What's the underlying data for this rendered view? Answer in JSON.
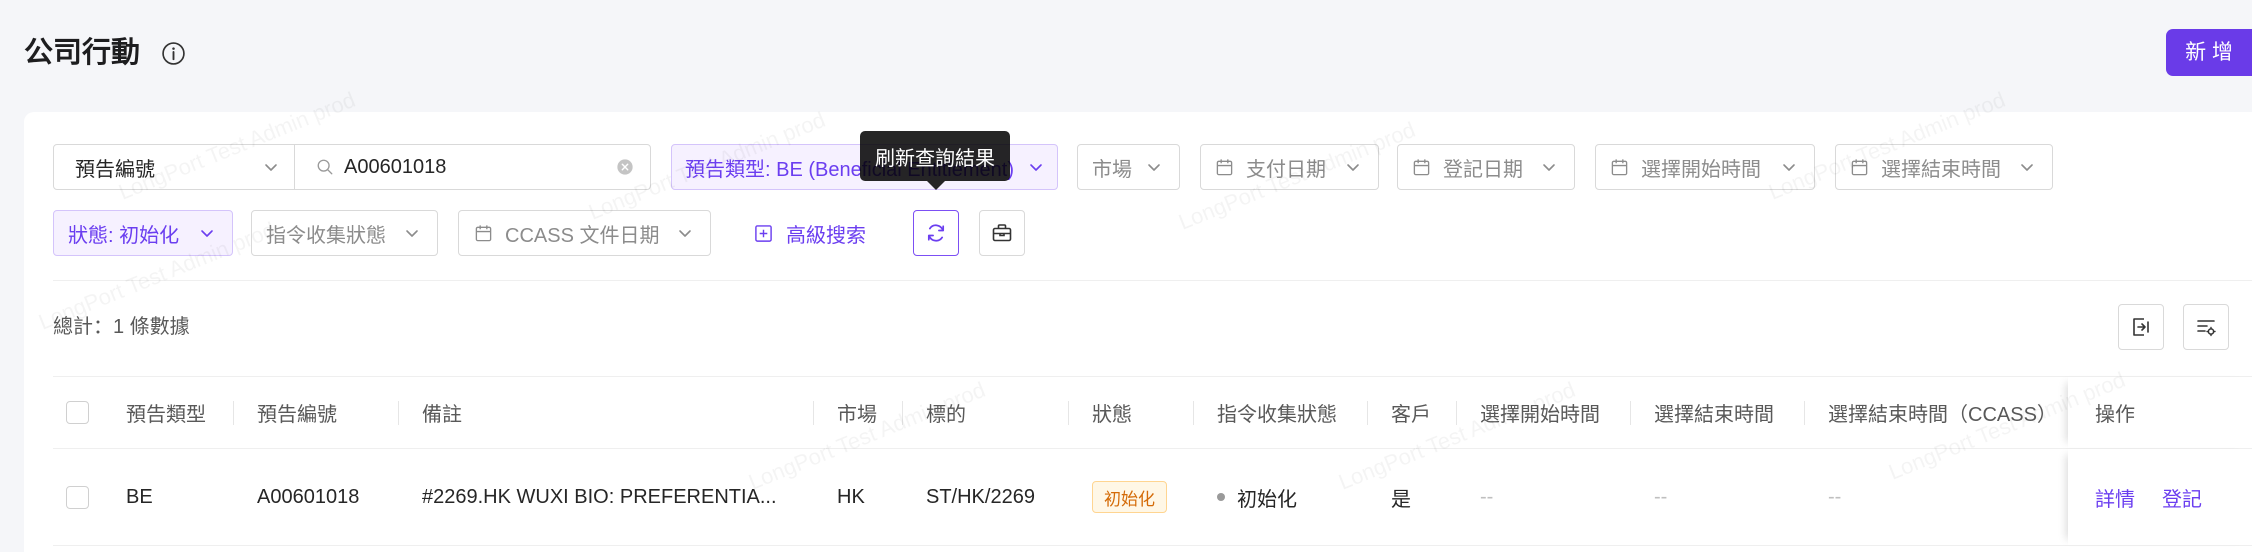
{
  "header": {
    "title": "公司行動",
    "add_button": "新 增"
  },
  "filters": {
    "search_field_select": "預告編號",
    "search_value": "A00601018",
    "notice_type": "預告類型: BE (Beneficial Entitlement)",
    "market_placeholder": "市場",
    "payment_date_placeholder": "支付日期",
    "record_date_placeholder": "登記日期",
    "select_start_placeholder": "選擇開始時間",
    "select_end_placeholder": "選擇結束時間",
    "status": "狀態: 初始化",
    "instruction_status_placeholder": "指令收集狀態",
    "ccass_date_placeholder": "CCASS 文件日期",
    "advanced_search": "高級搜索",
    "refresh_tooltip": "刷新查詢結果"
  },
  "summary": {
    "total": "總計：1 條數據"
  },
  "table": {
    "columns": [
      "預告類型",
      "預告編號",
      "備註",
      "市場",
      "標的",
      "狀態",
      "指令收集狀態",
      "客戶",
      "選擇開始時間",
      "選擇結束時間",
      "選擇結束時間（CCASS）",
      "操作"
    ],
    "rows": [
      {
        "type": "BE",
        "notice_no": "A00601018",
        "remark": "#2269.HK WUXI BIO: PREFERENTIA...",
        "market": "HK",
        "underlying": "ST/HK/2269",
        "status": "初始化",
        "instruction_status": "初始化",
        "client": "是",
        "select_start": "--",
        "select_end": "--",
        "select_end_ccass": "--",
        "actions": [
          "詳情",
          "登記"
        ]
      }
    ]
  },
  "watermark": "LongPort Test Admin prod",
  "colors": {
    "primary": "#6b3ef0",
    "add_button": "#6a3be8",
    "tag_warning_bg": "#fff7e6",
    "tag_warning_border": "#ffd591",
    "tag_warning_text": "#d46b08",
    "page_bg": "#f5f6f9"
  },
  "icons": {
    "title_info": "info-circle-icon",
    "dropdown": "chevron-down-icon",
    "search": "search-icon",
    "clear": "clear-icon",
    "date": "calendar-icon",
    "advanced_search": "plus-square-icon",
    "refresh": "refresh-icon",
    "toolbox": "toolbox-icon",
    "export": "export-icon",
    "column_settings": "column-settings-icon"
  }
}
